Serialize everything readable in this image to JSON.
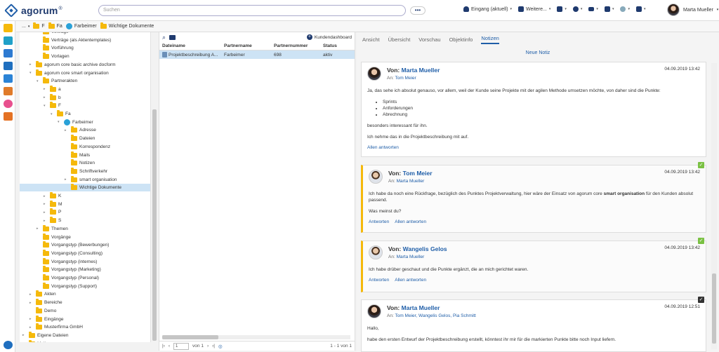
{
  "app": {
    "name": "agorum",
    "logo_mark": "®"
  },
  "search": {
    "placeholder": "Suchen",
    "menu_label": "•••"
  },
  "top_actions": [
    {
      "label": "Eingang (aktuell)",
      "icon": "bell-icon"
    },
    {
      "label": "Weitere...",
      "icon": "user-download-icon"
    },
    {
      "label": "",
      "icon": "folder-icon"
    },
    {
      "label": "",
      "icon": "play-icon"
    },
    {
      "label": "",
      "icon": "menu-icon"
    },
    {
      "label": "",
      "icon": "bank-icon"
    },
    {
      "label": "",
      "icon": "globe-icon"
    },
    {
      "label": "",
      "icon": "briefcase-icon"
    }
  ],
  "user": {
    "name": "Marta Mueller"
  },
  "breadcrumb": [
    "...",
    "F",
    "Fa",
    "Farbeimer",
    "Wichtige Dokumente"
  ],
  "tree": [
    {
      "label": "Verträge",
      "level": 2,
      "toggle": ""
    },
    {
      "label": "Verträge (als Aktentemplates)",
      "level": 2,
      "toggle": ""
    },
    {
      "label": "Vorführung",
      "level": 2,
      "toggle": ""
    },
    {
      "label": "Vorlagen",
      "level": 2,
      "toggle": ""
    },
    {
      "label": "agorum core basic archive docform",
      "level": 1,
      "toggle": "▸"
    },
    {
      "label": "agorum core smart organisation",
      "level": 1,
      "toggle": "▾"
    },
    {
      "label": "Partnerakten",
      "level": 2,
      "toggle": "▾"
    },
    {
      "label": "a",
      "level": 3,
      "toggle": "▸"
    },
    {
      "label": "b",
      "level": 3,
      "toggle": "▸"
    },
    {
      "label": "F",
      "level": 3,
      "toggle": "▾"
    },
    {
      "label": "Fa",
      "level": 4,
      "toggle": "▾"
    },
    {
      "label": "Farbeimer",
      "level": 5,
      "toggle": "▾",
      "person": true
    },
    {
      "label": "Adresse",
      "level": 6,
      "toggle": "▸"
    },
    {
      "label": "Dateien",
      "level": 6,
      "toggle": ""
    },
    {
      "label": "Korrespondenz",
      "level": 6,
      "toggle": ""
    },
    {
      "label": "Mails",
      "level": 6,
      "toggle": ""
    },
    {
      "label": "Notizen",
      "level": 6,
      "toggle": ""
    },
    {
      "label": "Schriftverkehr",
      "level": 6,
      "toggle": ""
    },
    {
      "label": "smart organisation",
      "level": 6,
      "toggle": "▸"
    },
    {
      "label": "Wichtige Dokumente",
      "level": 6,
      "toggle": "",
      "selected": true
    },
    {
      "label": "K",
      "level": 3,
      "toggle": "▸"
    },
    {
      "label": "M",
      "level": 3,
      "toggle": "▸"
    },
    {
      "label": "P",
      "level": 3,
      "toggle": "▸"
    },
    {
      "label": "S",
      "level": 3,
      "toggle": "▸"
    },
    {
      "label": "Themen",
      "level": 2,
      "toggle": "▸"
    },
    {
      "label": "Vorgänge",
      "level": 2,
      "toggle": ""
    },
    {
      "label": "Vorgangstyp (Bewerbungen)",
      "level": 2,
      "toggle": ""
    },
    {
      "label": "Vorgangstyp (Consulting)",
      "level": 2,
      "toggle": ""
    },
    {
      "label": "Vorgangstyp (internes)",
      "level": 2,
      "toggle": ""
    },
    {
      "label": "Vorgangstyp (Marketing)",
      "level": 2,
      "toggle": ""
    },
    {
      "label": "Vorgangstyp (Personal)",
      "level": 2,
      "toggle": ""
    },
    {
      "label": "Vorgangstyp (Support)",
      "level": 2,
      "toggle": ""
    },
    {
      "label": "Akten",
      "level": 1,
      "toggle": "▸"
    },
    {
      "label": "Bereiche",
      "level": 1,
      "toggle": "▸"
    },
    {
      "label": "Demo",
      "level": 1,
      "toggle": ""
    },
    {
      "label": "Eingänge",
      "level": 1,
      "toggle": "▸"
    },
    {
      "label": "Musterfirma GmbH",
      "level": 1,
      "toggle": "▸"
    },
    {
      "label": "Eigene Dateien",
      "level": 0,
      "toggle": "▸"
    },
    {
      "label": "Mail",
      "level": 0,
      "toggle": "▸"
    }
  ],
  "list": {
    "dashboard_label": "Kundendashboard",
    "columns": [
      "Dateiname",
      "Partnername",
      "Partnernummer",
      "Status"
    ],
    "rows": [
      [
        "Projektbeschreibung A...",
        "Farbeimer",
        "698",
        "aktiv"
      ]
    ],
    "page_value": "1",
    "page_of": "von 1",
    "range": "1 - 1 von 1"
  },
  "tabs": [
    "Ansicht",
    "Übersicht",
    "Vorschau",
    "Objektinfo",
    "Notizen"
  ],
  "active_tab": "Notizen",
  "new_note_label": "Neue Notiz",
  "notes": [
    {
      "von_label": "Von:",
      "from": "Marta Mueller",
      "an_label": "An:",
      "to": "Tom Meier",
      "date": "04.09.2019 13:42",
      "body": [
        "Ja, das sehe ich absolut genauso, vor allem, weil der Kunde seine Projekte mit der agilen Methode umsetzen möchte, von daher sind die Punkte:",
        "besonders interessant für ihn.",
        "Ich nehme das in die Projektbeschreibung mit auf."
      ],
      "bullets": [
        "Sprints",
        "Anforderungen",
        "Abrechnung"
      ],
      "links": [
        "Allen antworten"
      ]
    },
    {
      "von_label": "Von:",
      "from": "Tom Meier",
      "an_label": "An:",
      "to": "Marta Mueller",
      "date": "04.09.2019 13:42",
      "body_pre": "Ich habe da noch eine Rückfrage, bezüglich des Punktes Projektverwaltung, hier wäre der Einsatz von agorum core ",
      "body_bold": "smart organisation",
      "body_post": " für den Kunden absolut passend.",
      "body2": "Was meinst du?",
      "links": [
        "Antworten",
        "Allen antworten"
      ]
    },
    {
      "von_label": "Von:",
      "from": "Wangelis Gelos",
      "an_label": "An:",
      "to": "Marta Mueller",
      "date": "04.09.2019 13:42",
      "body": [
        "Ich habe drüber geschaut und die Punkte ergänzt, die an mich gerichtet waren."
      ],
      "links": [
        "Antworten",
        "Allen antworten"
      ]
    },
    {
      "von_label": "Von:",
      "from": "Marta Mueller",
      "an_label": "An:",
      "to": "Tom Meier, Wangelis Gelos, Pia Schmitt",
      "date": "04.09.2019 12:51",
      "body": [
        "Hallo,",
        "habe den ersten Entwurf der Projektbeschreibung erstellt, könntest ihr mir für die markierten Punkte bitte noch Input liefern."
      ]
    }
  ],
  "colors": {
    "accent": "#1f5ea8",
    "folder": "#f5b90b",
    "selected": "#cde3f5",
    "check_green": "#7ac143"
  }
}
